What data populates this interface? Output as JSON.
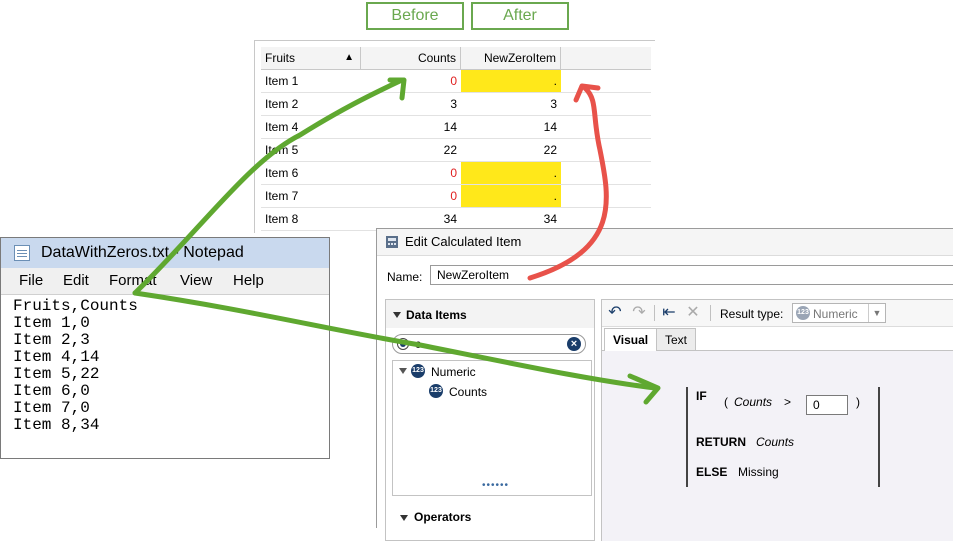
{
  "labels": {
    "before": "Before",
    "after": "After"
  },
  "table": {
    "headers": [
      "Fruits",
      "Counts",
      "NewZeroItem"
    ],
    "sort_indicator": "▲",
    "rows": [
      {
        "fruit": "Item 1",
        "count": "0",
        "new": ".",
        "zero": true
      },
      {
        "fruit": "Item 2",
        "count": "3",
        "new": "3",
        "zero": false
      },
      {
        "fruit": "Item 4",
        "count": "14",
        "new": "14",
        "zero": false
      },
      {
        "fruit": "Item 5",
        "count": "22",
        "new": "22",
        "zero": false
      },
      {
        "fruit": "Item 6",
        "count": "0",
        "new": ".",
        "zero": true
      },
      {
        "fruit": "Item 7",
        "count": "0",
        "new": ".",
        "zero": true
      },
      {
        "fruit": "Item 8",
        "count": "34",
        "new": "34",
        "zero": false
      }
    ]
  },
  "notepad": {
    "title": "DataWithZeros.txt - Notepad",
    "menu": [
      "File",
      "Edit",
      "Format",
      "View",
      "Help"
    ],
    "lines": [
      "Fruits,Counts",
      "Item 1,0",
      "Item 2,3",
      "Item 4,14",
      "Item 5,22",
      "Item 6,0",
      "Item 7,0",
      "Item 8,34"
    ]
  },
  "dialog": {
    "title": "Edit Calculated Item",
    "name_label": "Name:",
    "name_value": "NewZeroItem",
    "data_items_header": "Data Items",
    "search_value": "c",
    "tree_group": "Numeric",
    "tree_item": "Counts",
    "operators_header": "Operators",
    "result_type_label": "Result type:",
    "result_type_value": "Numeric",
    "tabs": [
      "Visual",
      "Text"
    ],
    "expression": {
      "if": "IF",
      "open_paren": "(",
      "field": "Counts",
      "op": ">",
      "value": "0",
      "close_paren": ")",
      "return_kw": "RETURN",
      "return_val": "Counts",
      "else_kw": "ELSE",
      "else_val": "Missing"
    }
  },
  "colors": {
    "arrow_green": "#5fa830",
    "arrow_red": "#e8524a",
    "highlight": "#ffe81a",
    "zero_text": "#e02020",
    "tag_border": "#6aa84f"
  }
}
